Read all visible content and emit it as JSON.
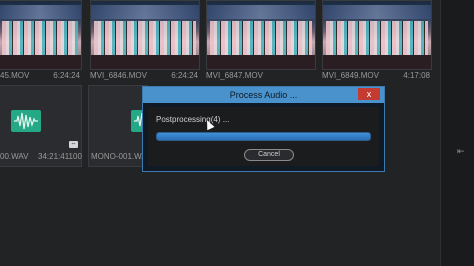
{
  "clips": [
    {
      "name": "45.MOV",
      "duration": "6:24:24"
    },
    {
      "name": "MVI_6846.MOV",
      "duration": "6:24:24"
    },
    {
      "name": "MVI_6847.MOV",
      "duration": ""
    },
    {
      "name": "MVI_6849.MOV",
      "duration": "4:17:08"
    }
  ],
  "audio": [
    {
      "name": "00.WAV",
      "duration": "34:21:41100"
    },
    {
      "name": "MONO-001.WAV",
      "duration": ""
    }
  ],
  "dialog": {
    "title": "Process Audio ...",
    "close": "x",
    "status": "Postprocessing(4) ...",
    "progress": 1.0,
    "cancel": "Cancel"
  },
  "colors": {
    "accent": "#4a92cc",
    "close": "#c43b31",
    "wave": "#25a885"
  }
}
